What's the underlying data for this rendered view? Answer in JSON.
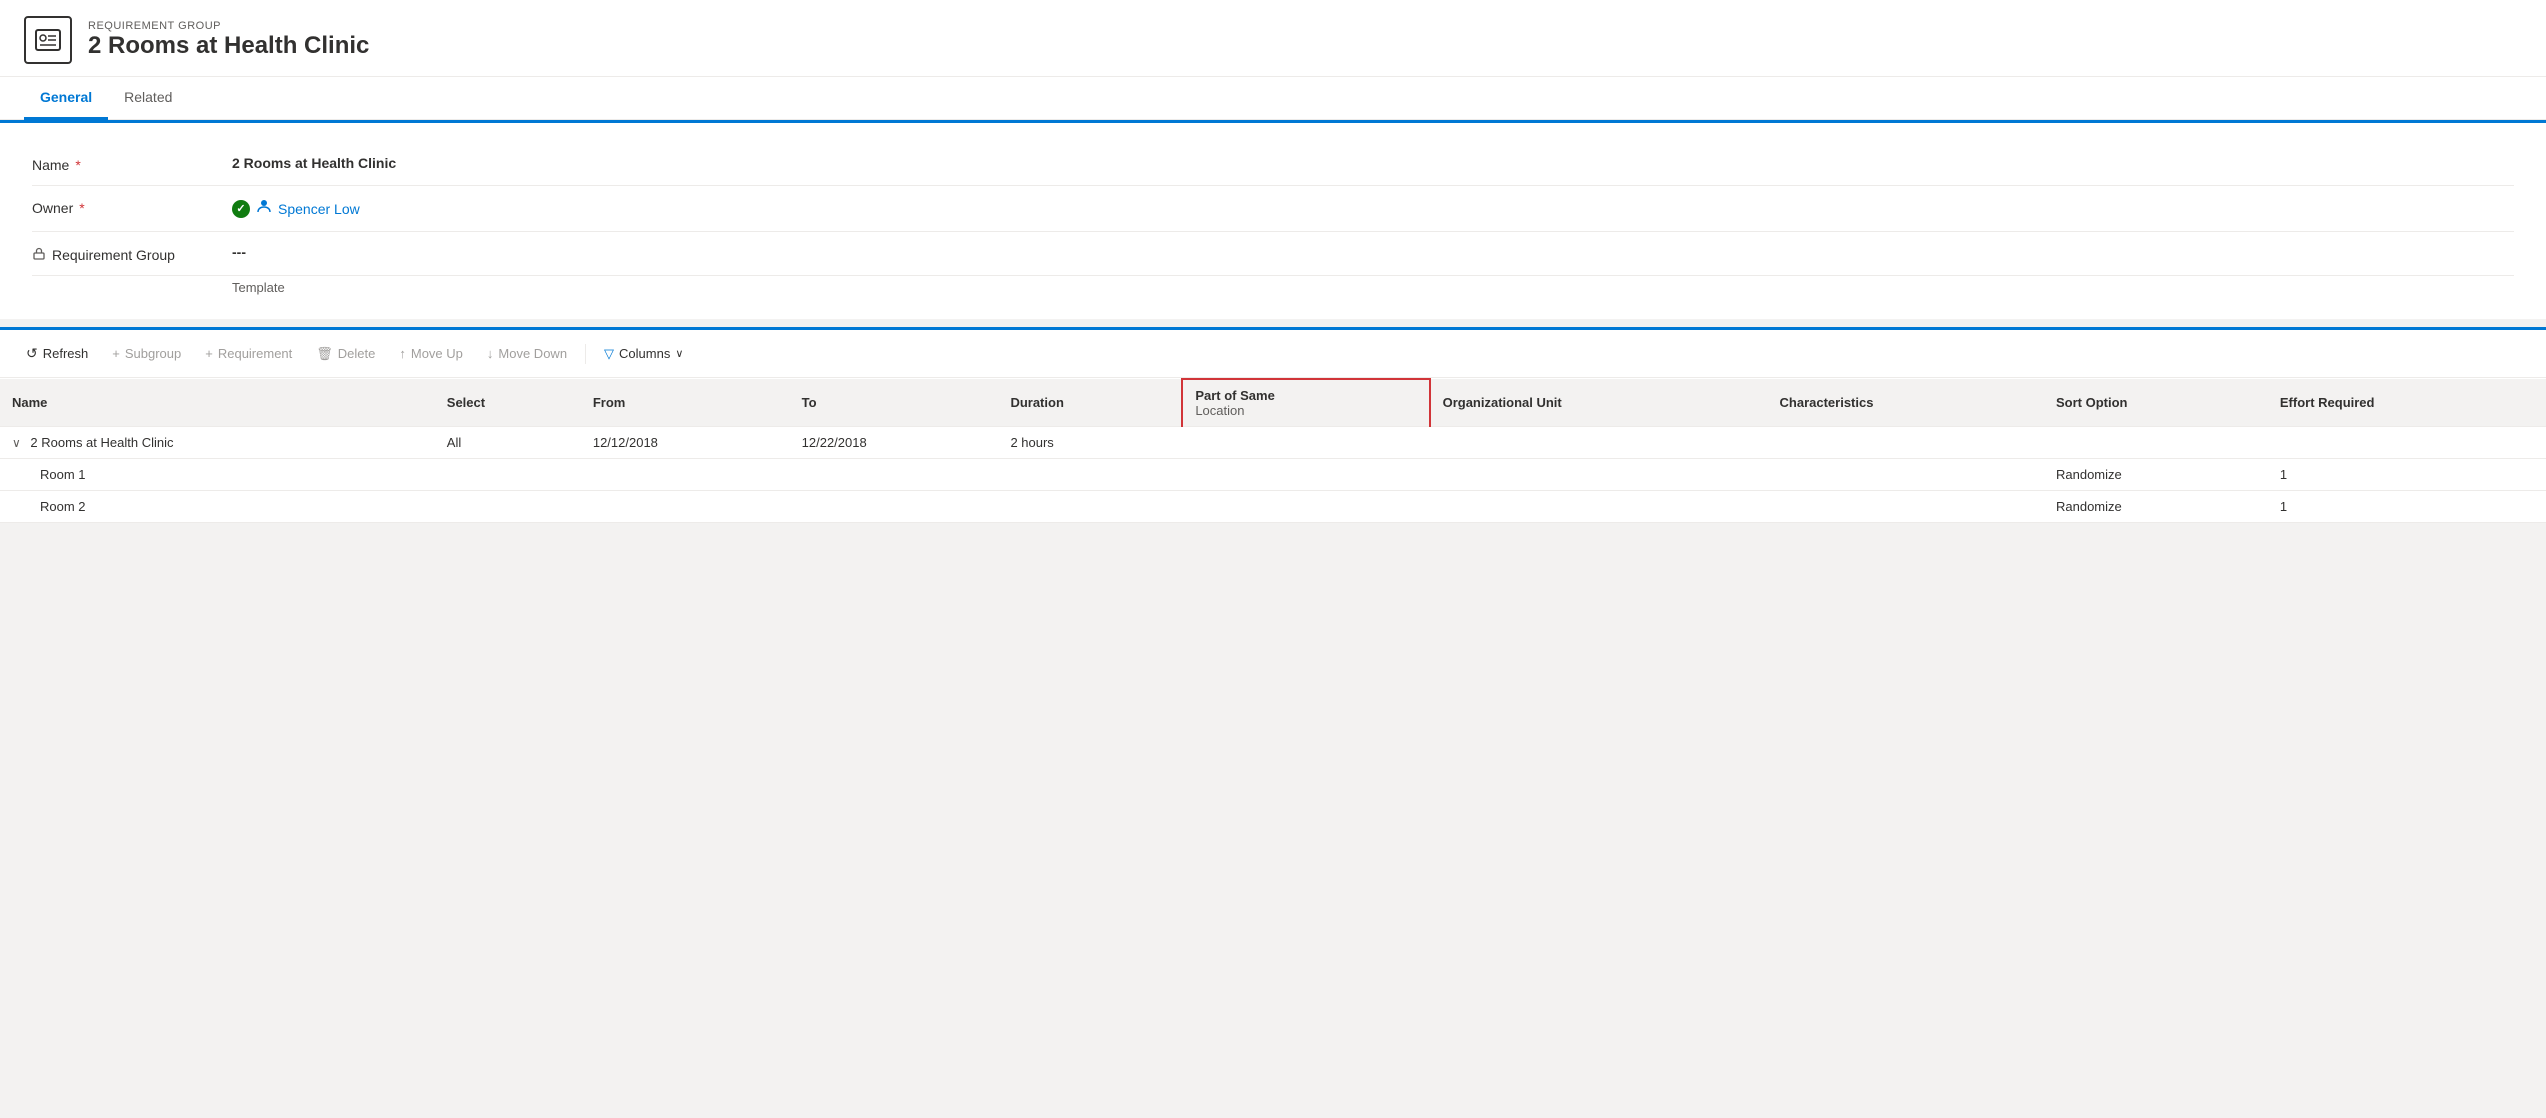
{
  "header": {
    "subtitle": "REQUIREMENT GROUP",
    "title": "2 Rooms at Health Clinic"
  },
  "tabs": [
    {
      "label": "General",
      "active": true
    },
    {
      "label": "Related",
      "active": false
    }
  ],
  "form": {
    "rows": [
      {
        "label": "Name",
        "required": true,
        "value": "2 Rooms at Health Clinic",
        "type": "text"
      },
      {
        "label": "Owner",
        "required": true,
        "value": "Spencer Low",
        "type": "owner"
      },
      {
        "label": "Requirement Group Template",
        "required": false,
        "value": "---",
        "type": "text",
        "hasLock": true
      }
    ]
  },
  "toolbar": {
    "refresh_label": "Refresh",
    "subgroup_label": "Subgroup",
    "requirement_label": "Requirement",
    "delete_label": "Delete",
    "moveup_label": "Move Up",
    "movedown_label": "Move Down",
    "columns_label": "Columns"
  },
  "table": {
    "columns": [
      {
        "id": "name",
        "label": "Name"
      },
      {
        "id": "select",
        "label": "Select"
      },
      {
        "id": "from",
        "label": "From"
      },
      {
        "id": "to",
        "label": "To"
      },
      {
        "id": "duration",
        "label": "Duration"
      },
      {
        "id": "part_of_same",
        "label": "Part of Same",
        "sub_label": "Location",
        "highlighted": true
      },
      {
        "id": "org_unit",
        "label": "Organizational Unit"
      },
      {
        "id": "characteristics",
        "label": "Characteristics"
      },
      {
        "id": "sort_option",
        "label": "Sort Option"
      },
      {
        "id": "effort_required",
        "label": "Effort Required"
      }
    ],
    "rows": [
      {
        "type": "group",
        "name": "2 Rooms at Health Clinic",
        "expanded": true,
        "select": "All",
        "from": "12/12/2018",
        "to": "12/22/2018",
        "duration": "2 hours",
        "part_of_same": "",
        "org_unit": "",
        "characteristics": "",
        "sort_option": "",
        "effort_required": ""
      },
      {
        "type": "child",
        "name": "Room 1",
        "select": "",
        "from": "",
        "to": "",
        "duration": "",
        "part_of_same": "",
        "org_unit": "",
        "characteristics": "",
        "sort_option": "Randomize",
        "effort_required": "1"
      },
      {
        "type": "child",
        "name": "Room 2",
        "select": "",
        "from": "",
        "to": "",
        "duration": "",
        "part_of_same": "",
        "org_unit": "",
        "characteristics": "",
        "sort_option": "Randomize",
        "effort_required": "1"
      }
    ]
  }
}
